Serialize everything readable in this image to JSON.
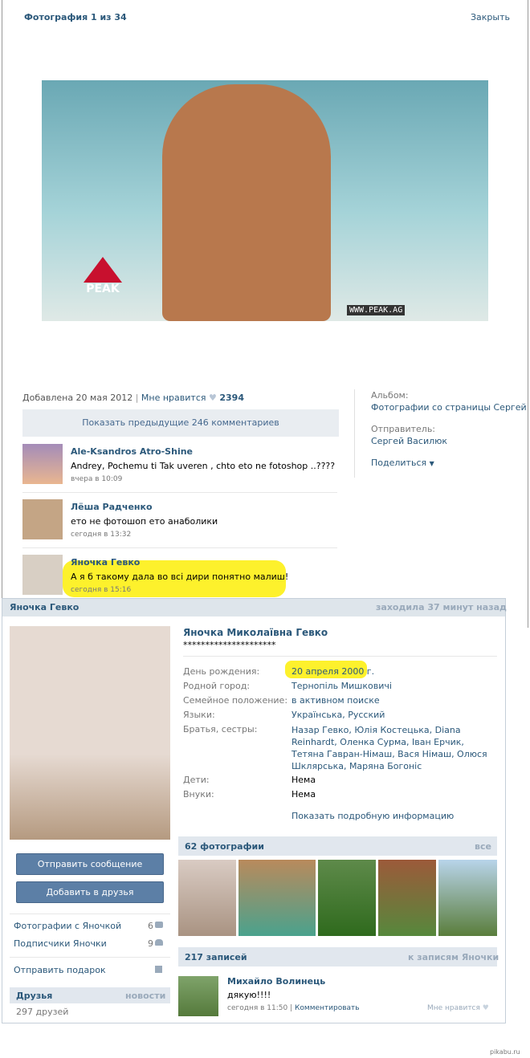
{
  "viewer": {
    "title": "Фотография 1 из 34",
    "close": "Закрыть",
    "photo_alt": "photo of bodybuilder on beach",
    "watermark_logo": "PEAK INTERNATIONAL",
    "watermark_url": "WWW.PEAK.AG"
  },
  "info": {
    "added": "Добавлена 20 мая 2012",
    "sep": "|",
    "like": "Мне нравится",
    "like_count": "2394",
    "show_prev": "Показать предыдущие 246 комментариев"
  },
  "side": {
    "album_label": "Альбом:",
    "album": "Фотографии со страницы Сергей",
    "sender_label": "Отправитель:",
    "sender": "Сергей Василюк",
    "share": "Поделиться"
  },
  "comments": [
    {
      "name": "Ale-Ksandros Atro-Shine",
      "text": "Andrey, Pochemu ti Tak uveren , chto eto ne fotoshop ..????",
      "time": "вчера в 10:09"
    },
    {
      "name": "Лёша Радченко",
      "text": "ето не фотошоп ето анаболики",
      "time": "сегодня в 13:32"
    },
    {
      "name": "Яночка Гевко",
      "text": "А я б такому дала во всі дири понятно малиш!",
      "time": "сегодня в 15:16"
    }
  ],
  "profile": {
    "header_name": "Яночка Гевко",
    "last_seen": "заходила 37 минут назад",
    "full_name": "Яночка Миколаївна Гевко",
    "status": "*********************",
    "rows": [
      {
        "label": "День рождения:",
        "value": "20 апреля 2000 г."
      },
      {
        "label": "Родной город:",
        "value": "Тернопіль Мишковичі"
      },
      {
        "label": "Семейное положение:",
        "value": "в активном поиске"
      },
      {
        "label": "Языки:",
        "value": "Українська, Русский"
      },
      {
        "label": "Братья, сестры:",
        "value": "Назар Гевко, Юлія Костецька, Diana Reinhardt, Оленка Сурма, Іван Ерчик, Тетяна Гавран-Німаш, Вася Німаш, Олюся Шклярська, Маряна Богоніс"
      },
      {
        "label": "Дети:",
        "value": "Нема"
      },
      {
        "label": "Внуки:",
        "value": "Нема"
      }
    ],
    "more_info": "Показать подробную информацию",
    "send_msg": "Отправить сообщение",
    "add_friend": "Добавить в друзья",
    "menu": [
      {
        "label": "Фотографии с Яночкой",
        "count": "6"
      },
      {
        "label": "Подписчики Яночки",
        "count": "9"
      }
    ],
    "gift": "Отправить подарок",
    "friends_head": "Друзья",
    "news": "новости",
    "friends_count": "297 друзей",
    "photos_head": "62 фотографии",
    "all": "все",
    "posts_head": "217 записей",
    "to_posts": "к записям Яночки",
    "post": {
      "author": "Михайло Волинець",
      "text": "дякую!!!!",
      "time": "сегодня в 11:50",
      "sep": "|",
      "comment": "Комментировать",
      "like": "Мне нравится"
    }
  },
  "footer": {
    "source": "pikabu.ru"
  },
  "colors": {
    "link": "#2b587a",
    "highlight": "#fdf12c",
    "header_bg": "#e1e7ee",
    "button": "#5c7fa6"
  }
}
